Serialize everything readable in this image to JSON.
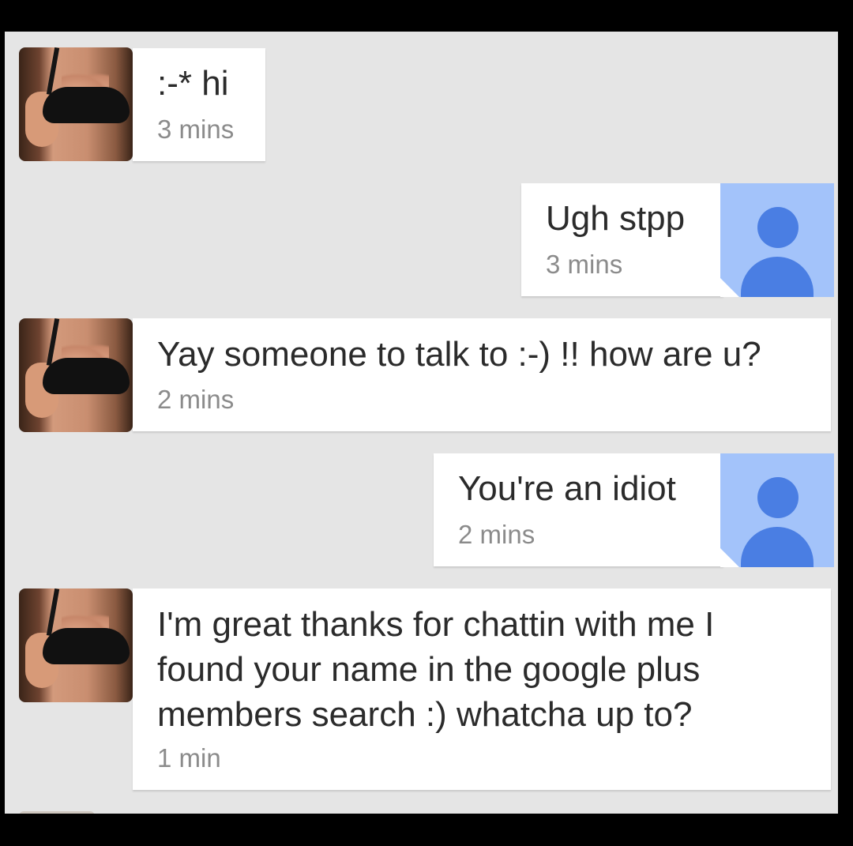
{
  "messages": [
    {
      "sender": "other",
      "text": ":-* hi",
      "time": "3 mins"
    },
    {
      "sender": "me",
      "text": "Ugh stpp",
      "time": "3 mins"
    },
    {
      "sender": "other",
      "text": "Yay someone to talk to :-) !! how are u?",
      "time": "2 mins"
    },
    {
      "sender": "me",
      "text": "You're an idiot",
      "time": "2 mins"
    },
    {
      "sender": "other",
      "text": "I'm great thanks for chattin with me I\nfound your name in the google plus\nmembers search :) whatcha up to?",
      "time": "1 min"
    }
  ],
  "icons": {
    "other_avatar": "profile-photo",
    "me_avatar": "default-person-icon"
  },
  "colors": {
    "background": "#e5e5e5",
    "bubble": "#ffffff",
    "me_avatar_bg": "#a3c3fa",
    "me_avatar_fg": "#4a7ee3",
    "timestamp": "#8b8b8b"
  }
}
